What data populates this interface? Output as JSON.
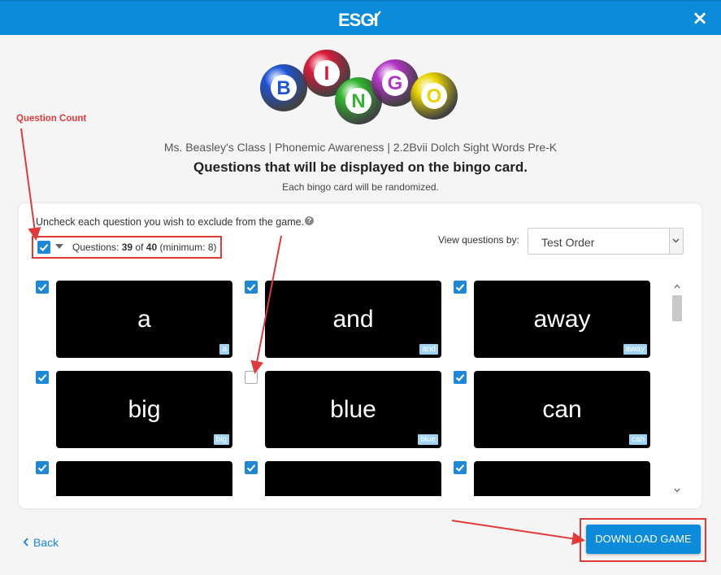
{
  "header": {
    "logo": "ESGI",
    "close_icon": "×"
  },
  "bingo_logo": {
    "letters": [
      "B",
      "I",
      "N",
      "G",
      "O"
    ],
    "colors": [
      "#1f54d6",
      "#d81b3a",
      "#31b52f",
      "#b335c7",
      "#e8d400"
    ]
  },
  "title_block": {
    "class_line": "Ms. Beasley's Class | Phonemic Awareness | 2.2Bvii Dolch Sight Words Pre-K",
    "heading": "Questions that will be displayed on the bingo card.",
    "subheading": "Each bingo card will be randomized."
  },
  "panel": {
    "instruction": "Uncheck each question you wish to exclude from the game.",
    "help_icon": "?",
    "question_count": {
      "label": "Questions:",
      "selected": "39",
      "of": "of",
      "total": "40",
      "minimum": "(minimum: 8)"
    },
    "view_by": {
      "label": "View questions by:",
      "value": "Test Order"
    },
    "questions": [
      {
        "word": "a",
        "tag": "a",
        "checked": true
      },
      {
        "word": "and",
        "tag": "and",
        "checked": true
      },
      {
        "word": "away",
        "tag": "away",
        "checked": true
      },
      {
        "word": "big",
        "tag": "big",
        "checked": true
      },
      {
        "word": "blue",
        "tag": "blue",
        "checked": false
      },
      {
        "word": "can",
        "tag": "can",
        "checked": true
      },
      {
        "word": "",
        "tag": "",
        "checked": true
      },
      {
        "word": "",
        "tag": "",
        "checked": true
      },
      {
        "word": "",
        "tag": "",
        "checked": true
      }
    ]
  },
  "footer": {
    "back_label": "Back",
    "download_label": "DOWNLOAD GAME"
  },
  "annotation": {
    "question_count_label": "Question Count"
  },
  "colors": {
    "brand_blue": "#0b8bd9",
    "checkbox_blue": "#1e88d6",
    "annotation_red": "#e03a3a",
    "tag_blue": "#9fd3ef"
  }
}
